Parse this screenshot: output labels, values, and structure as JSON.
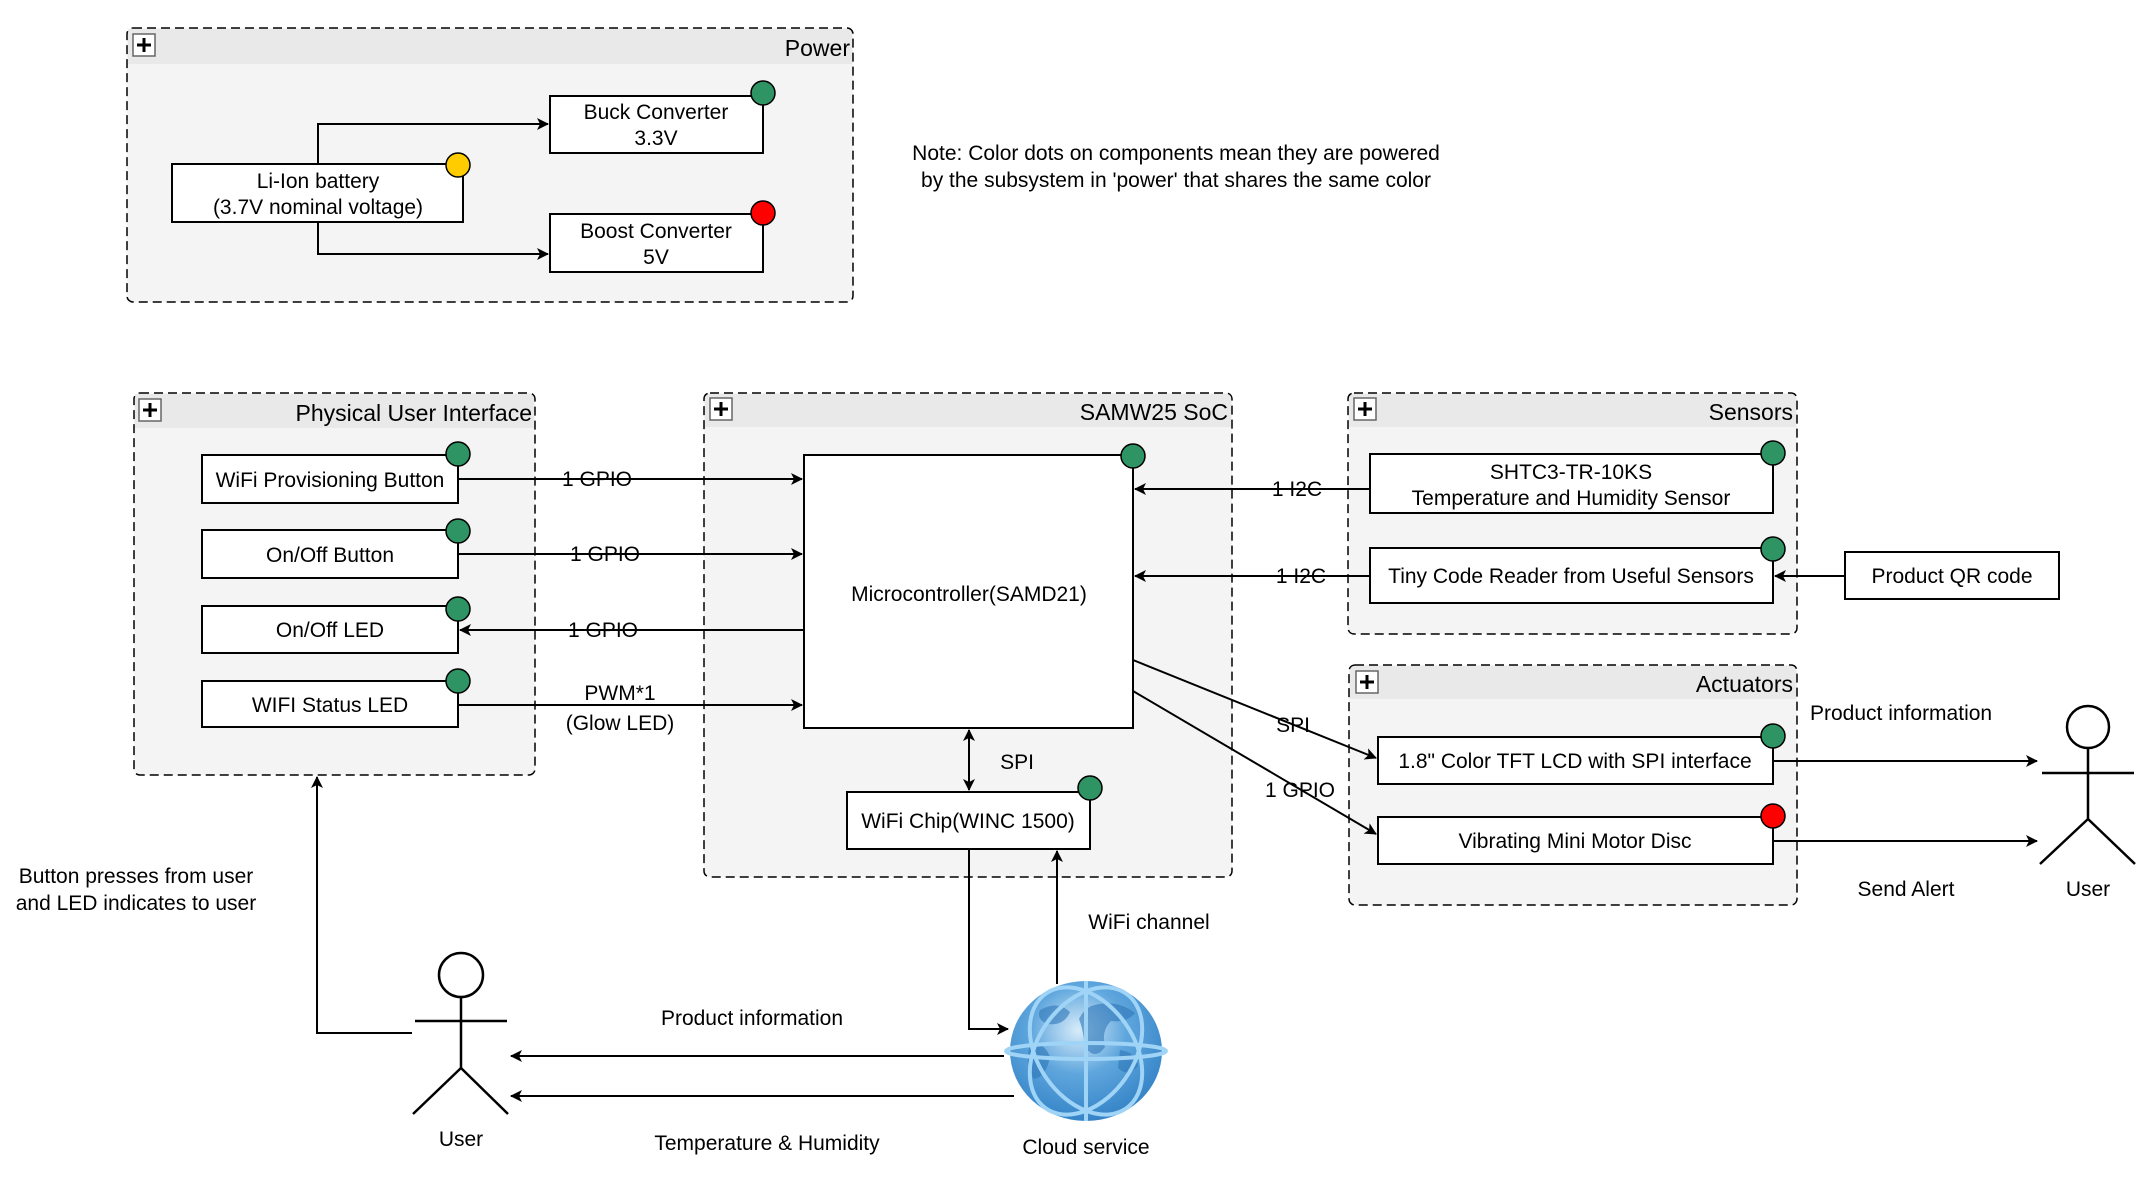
{
  "colors": {
    "green": "#2e9464",
    "yellow": "#ffcc00",
    "red": "#ff0000",
    "globe": "#3d8fd1",
    "globe_ring": "#9fd4f7"
  },
  "note": {
    "line1": "Note: Color dots on components mean they are powered",
    "line2": "by the subsystem in 'power' that shares the same color"
  },
  "groups": {
    "power": {
      "title": "Power",
      "battery": {
        "line1": "Li-Ion battery",
        "line2": "(3.7V nominal voltage)",
        "dot": "yellow"
      },
      "buck": {
        "line1": "Buck Converter",
        "line2": "3.3V",
        "dot": "green"
      },
      "boost": {
        "line1": "Boost Converter",
        "line2": "5V",
        "dot": "red"
      }
    },
    "pui": {
      "title": "Physical User Interface",
      "items": [
        {
          "label": "WiFi Provisioning Button",
          "dot": "green",
          "link": "1 GPIO"
        },
        {
          "label": "On/Off Button",
          "dot": "green",
          "link": "1 GPIO"
        },
        {
          "label": "On/Off LED",
          "dot": "green",
          "link": "1 GPIO"
        },
        {
          "label": "WIFI Status LED",
          "dot": "green",
          "link_line1": "PWM*1",
          "link_line2": "(Glow LED)"
        }
      ]
    },
    "soc": {
      "title": "SAMW25 SoC",
      "mcu": {
        "label": "Microcontroller(SAMD21)",
        "dot": "green"
      },
      "wifi_chip": {
        "label": "WiFi Chip(WINC 1500)",
        "dot": "green"
      },
      "spi_label": "SPI"
    },
    "sensors": {
      "title": "Sensors",
      "shtc3": {
        "line1": "SHTC3-TR-10KS",
        "line2": "Temperature and Humidity Sensor",
        "dot": "green",
        "link": "1 I2C"
      },
      "tiny": {
        "label": "Tiny Code Reader from Useful Sensors",
        "dot": "green",
        "link": "1 I2C"
      },
      "qr": {
        "label": "Product QR code"
      }
    },
    "actuators": {
      "title": "Actuators",
      "lcd": {
        "label": "1.8\" Color TFT LCD with SPI interface",
        "dot": "green",
        "link": "SPI"
      },
      "motor": {
        "label": "Vibrating Mini Motor Disc",
        "dot": "red",
        "link": "1 GPIO"
      }
    }
  },
  "actors": {
    "user_left": {
      "label": "User"
    },
    "user_right": {
      "label": "User"
    }
  },
  "cloud": {
    "label": "Cloud service",
    "wifi_channel": "WiFi channel"
  },
  "edges": {
    "user_to_pui": {
      "line1": "Button presses from user",
      "line2": "and LED indicates to user"
    },
    "cloud_product_info": "Product information",
    "cloud_temp_humidity": "Temperature & Humidity",
    "lcd_product_info": "Product information",
    "motor_alert": "Send Alert"
  }
}
